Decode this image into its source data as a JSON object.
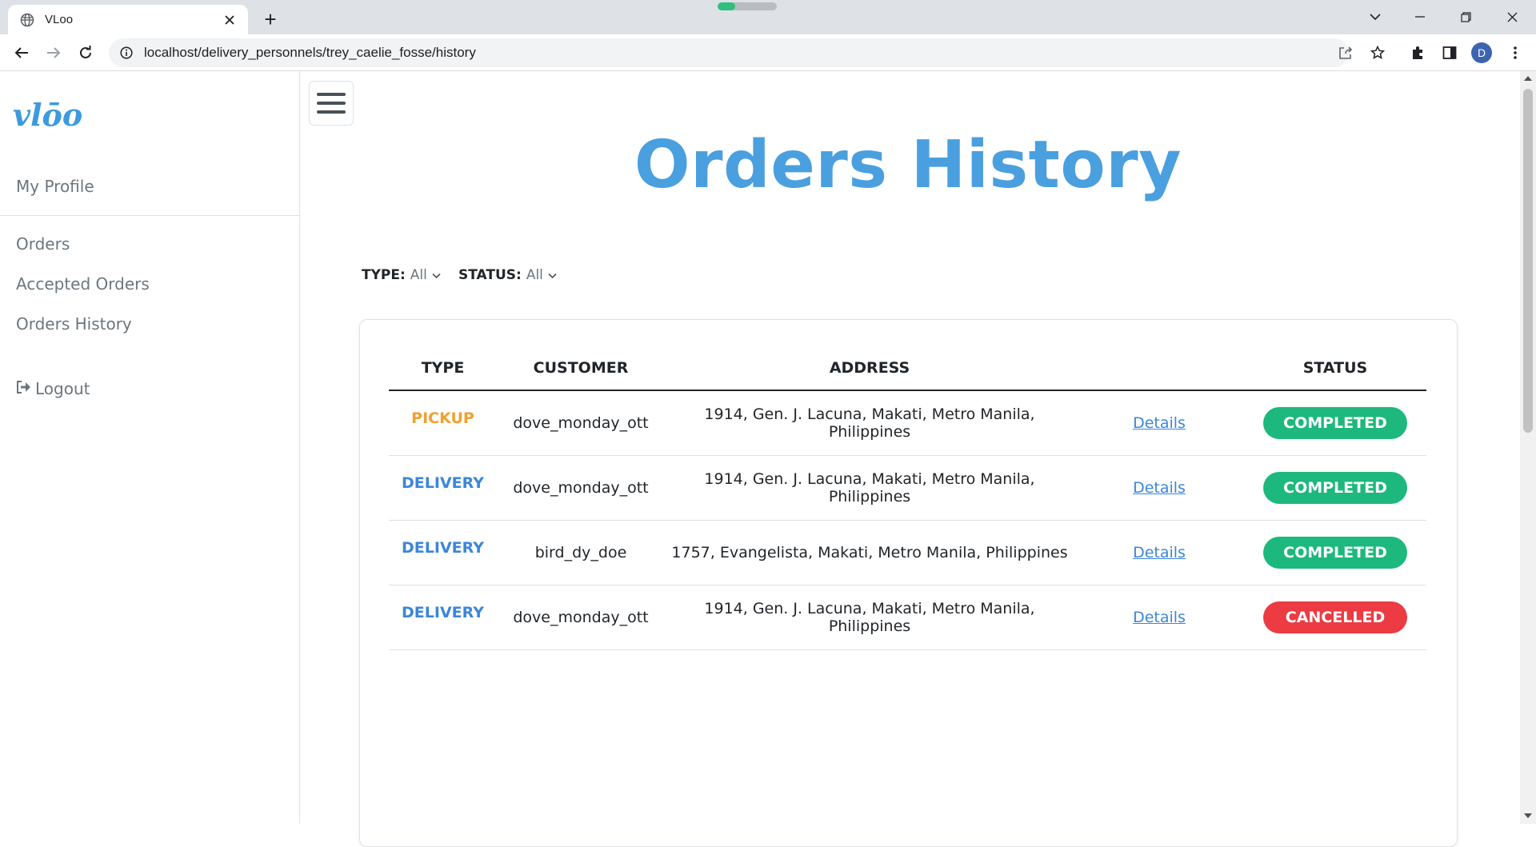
{
  "browser": {
    "tab_title": "VLoo",
    "new_tab_label": "+",
    "url": "localhost/delivery_personnels/trey_caelie_fosse/history",
    "profile_initial": "D"
  },
  "sidebar": {
    "logo_text": "vlōo",
    "my_profile": "My Profile",
    "items": [
      {
        "label": "Orders"
      },
      {
        "label": "Accepted Orders"
      },
      {
        "label": "Orders History"
      }
    ],
    "logout": "Logout"
  },
  "main": {
    "title": "Orders History",
    "filters": {
      "type_label": "TYPE:",
      "type_value": "All",
      "status_label": "STATUS:",
      "status_value": "All"
    },
    "table": {
      "headers": {
        "type": "TYPE",
        "customer": "CUSTOMER",
        "address": "ADDRESS",
        "details": "",
        "status": "STATUS"
      },
      "rows": [
        {
          "type": "PICKUP",
          "customer": "dove_monday_ott",
          "address": "1914, Gen. J. Lacuna, Makati, Metro Manila, Philippines",
          "details": "Details",
          "status": "COMPLETED"
        },
        {
          "type": "DELIVERY",
          "customer": "dove_monday_ott",
          "address": "1914, Gen. J. Lacuna, Makati, Metro Manila, Philippines",
          "details": "Details",
          "status": "COMPLETED"
        },
        {
          "type": "DELIVERY",
          "customer": "bird_dy_doe",
          "address": "1757, Evangelista, Makati, Metro Manila, Philippines",
          "details": "Details",
          "status": "COMPLETED"
        },
        {
          "type": "DELIVERY",
          "customer": "dove_monday_ott",
          "address": "1914, Gen. J. Lacuna, Makati, Metro Manila, Philippines",
          "details": "Details",
          "status": "CANCELLED"
        }
      ]
    }
  },
  "colors": {
    "accent": "#4a9fdf",
    "pickup": "#f0a030",
    "delivery": "#3c86d8",
    "completed": "#1db87d",
    "cancelled": "#ec3b43"
  }
}
